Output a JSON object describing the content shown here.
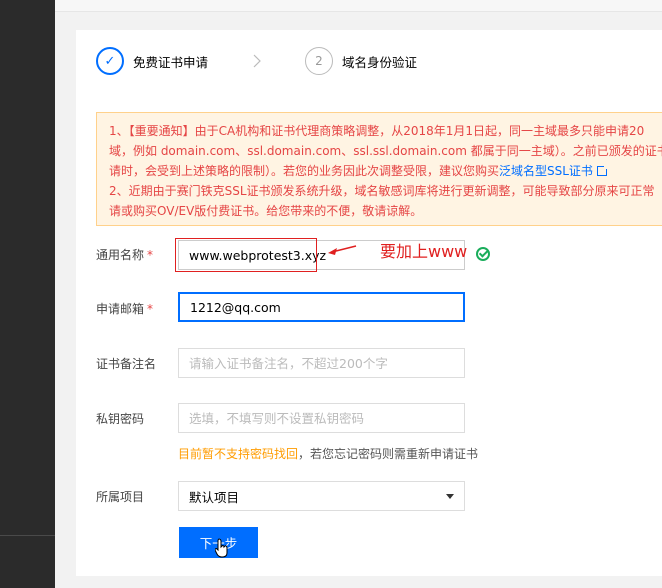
{
  "steps": [
    {
      "number": "✓",
      "label": "免费证书申请"
    },
    {
      "number": "2",
      "label": "域名身份验证"
    }
  ],
  "notice": {
    "line1": "1、【重要通知】由于CA机构和证书代理商策略调整，从2018年1月1日起，同一主域最多只能申请20",
    "line2": "域，例如 domain.com、ssl.domain.com、ssl.ssl.domain.com 都属于同一主域）。之前已颁发的证书",
    "line3_text": "请时，会受到上述策略的限制）。若您的业务因此次调整受限，建议您购买",
    "line3_link": "泛域名型SSL证书",
    "line4": "2、近期由于赛门铁克SSL证书颁发系统升级，域名敏感词库将进行更新调整，可能导致部分原来可正常",
    "line5": "请或购买OV/EV版付费证书。给您带来的不便，敬请谅解。"
  },
  "form": {
    "common_name": {
      "label": "通用名称",
      "value": "www.webprotest3.xyz"
    },
    "email": {
      "label": "申请邮箱",
      "value": "1212@qq.com"
    },
    "remark": {
      "label": "证书备注名",
      "placeholder": "请输入证书备注名，不超过200个字"
    },
    "key_password": {
      "label": "私钥密码",
      "placeholder": "选填，不填写则不设置私钥密码"
    },
    "hint_orange": "目前暂不支持密码找回",
    "hint_gray": "，若您忘记密码则需重新申请证书",
    "project": {
      "label": "所属项目",
      "value": "默认项目"
    },
    "required_mark": "*"
  },
  "next_button": "下一步",
  "annotation": "要加上www"
}
